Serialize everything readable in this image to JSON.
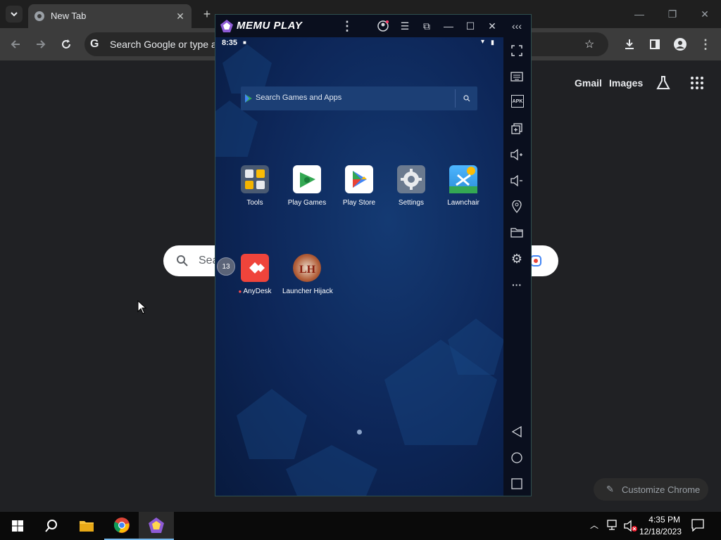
{
  "chrome": {
    "tab": {
      "title": "New Tab"
    },
    "omnibox": {
      "placeholder": "Search Google or type a"
    },
    "ntp": {
      "gmail_label": "Gmail",
      "images_label": "Images",
      "search_placeholder": "Sea",
      "customize_label": "Customize Chrome"
    }
  },
  "memu": {
    "title": "MEMU PLAY",
    "android": {
      "status_time": "8:35",
      "search_placeholder": "Search Games and Apps",
      "apps": [
        {
          "label": "Tools"
        },
        {
          "label": "Play Games"
        },
        {
          "label": "Play Store"
        },
        {
          "label": "Settings"
        },
        {
          "label": "Lawnchair"
        },
        {
          "label": "AnyDesk"
        },
        {
          "label": "Launcher Hijack"
        }
      ],
      "notification_badge": "13"
    },
    "sidebar": {
      "apk_label": "APK"
    }
  },
  "taskbar": {
    "time": "4:35 PM",
    "date": "12/18/2023"
  },
  "colors": {
    "chrome_dark": "#202124",
    "memu_bg": "#0c1f4f",
    "accent_blue": "#1a73e8"
  }
}
